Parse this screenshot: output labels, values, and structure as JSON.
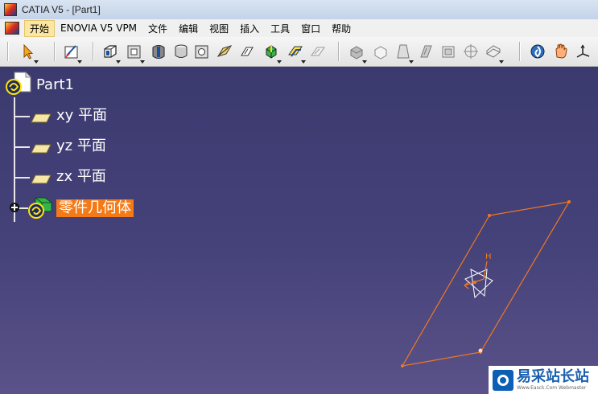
{
  "window": {
    "title": "CATIA V5 - [Part1]"
  },
  "menu": [
    "开始",
    "ENOVIA V5 VPM",
    "文件",
    "编辑",
    "视图",
    "插入",
    "工具",
    "窗口",
    "帮助"
  ],
  "toolbar": {
    "icons": [
      "select-arrow-icon",
      "sketch-icon",
      "pad-icon",
      "pocket-icon",
      "shaft-icon",
      "groove-icon",
      "hole-icon",
      "rib-icon",
      "slot-icon",
      "stiffener-icon",
      "multi-section-solid-icon",
      "removed-multi-section-icon",
      "edge-fillet-icon",
      "chamfer-icon",
      "draft-icon",
      "shell-icon",
      "thickness-icon",
      "thread-icon",
      "translation-icon",
      "axis-system-icon",
      "measure-icon",
      "hand-pan-icon",
      "axis-icon"
    ]
  },
  "tree": {
    "root": "Part1",
    "planes": [
      "xy 平面",
      "yz 平面",
      "zx 平面"
    ],
    "body": "零件几何体"
  },
  "viewport": {
    "axis_label": "H",
    "plane_color": "#f07820"
  },
  "watermark": {
    "brand": "易采站长站",
    "url": "Www.Easck.Com Webmaster"
  }
}
